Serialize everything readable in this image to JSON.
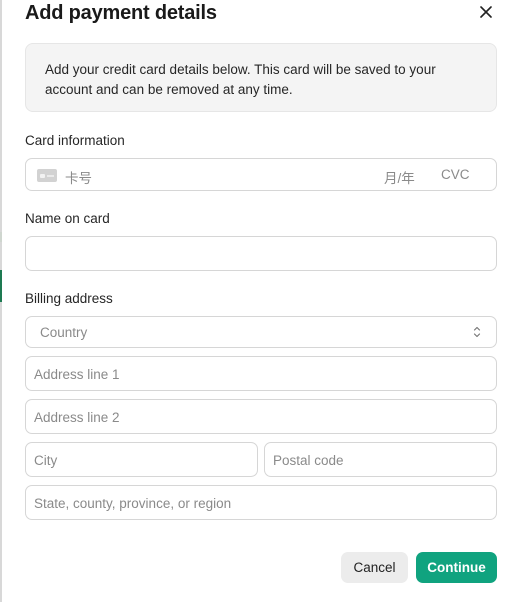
{
  "dialog": {
    "title": "Add payment details",
    "close_icon": "close-icon",
    "info_text": "Add your credit card details below. This card will be saved to your account and can be removed at any time."
  },
  "card_information": {
    "label": "Card information",
    "card_icon": "credit-card-icon",
    "number_placeholder": "卡号",
    "expiry_placeholder": "月/年",
    "cvc_placeholder": "CVC"
  },
  "name_on_card": {
    "label": "Name on card",
    "value": ""
  },
  "billing_address": {
    "label": "Billing address",
    "country_placeholder": "Country",
    "country_icon": "chevron-up-down-icon",
    "address_line1_placeholder": "Address line 1",
    "address_line2_placeholder": "Address line 2",
    "city_placeholder": "City",
    "postal_code_placeholder": "Postal code",
    "region_placeholder": "State, county, province, or region"
  },
  "actions": {
    "cancel_label": "Cancel",
    "continue_label": "Continue"
  },
  "colors": {
    "primary": "#10a37f",
    "info_background": "#f4f4f4",
    "border": "#d6d6d6"
  }
}
